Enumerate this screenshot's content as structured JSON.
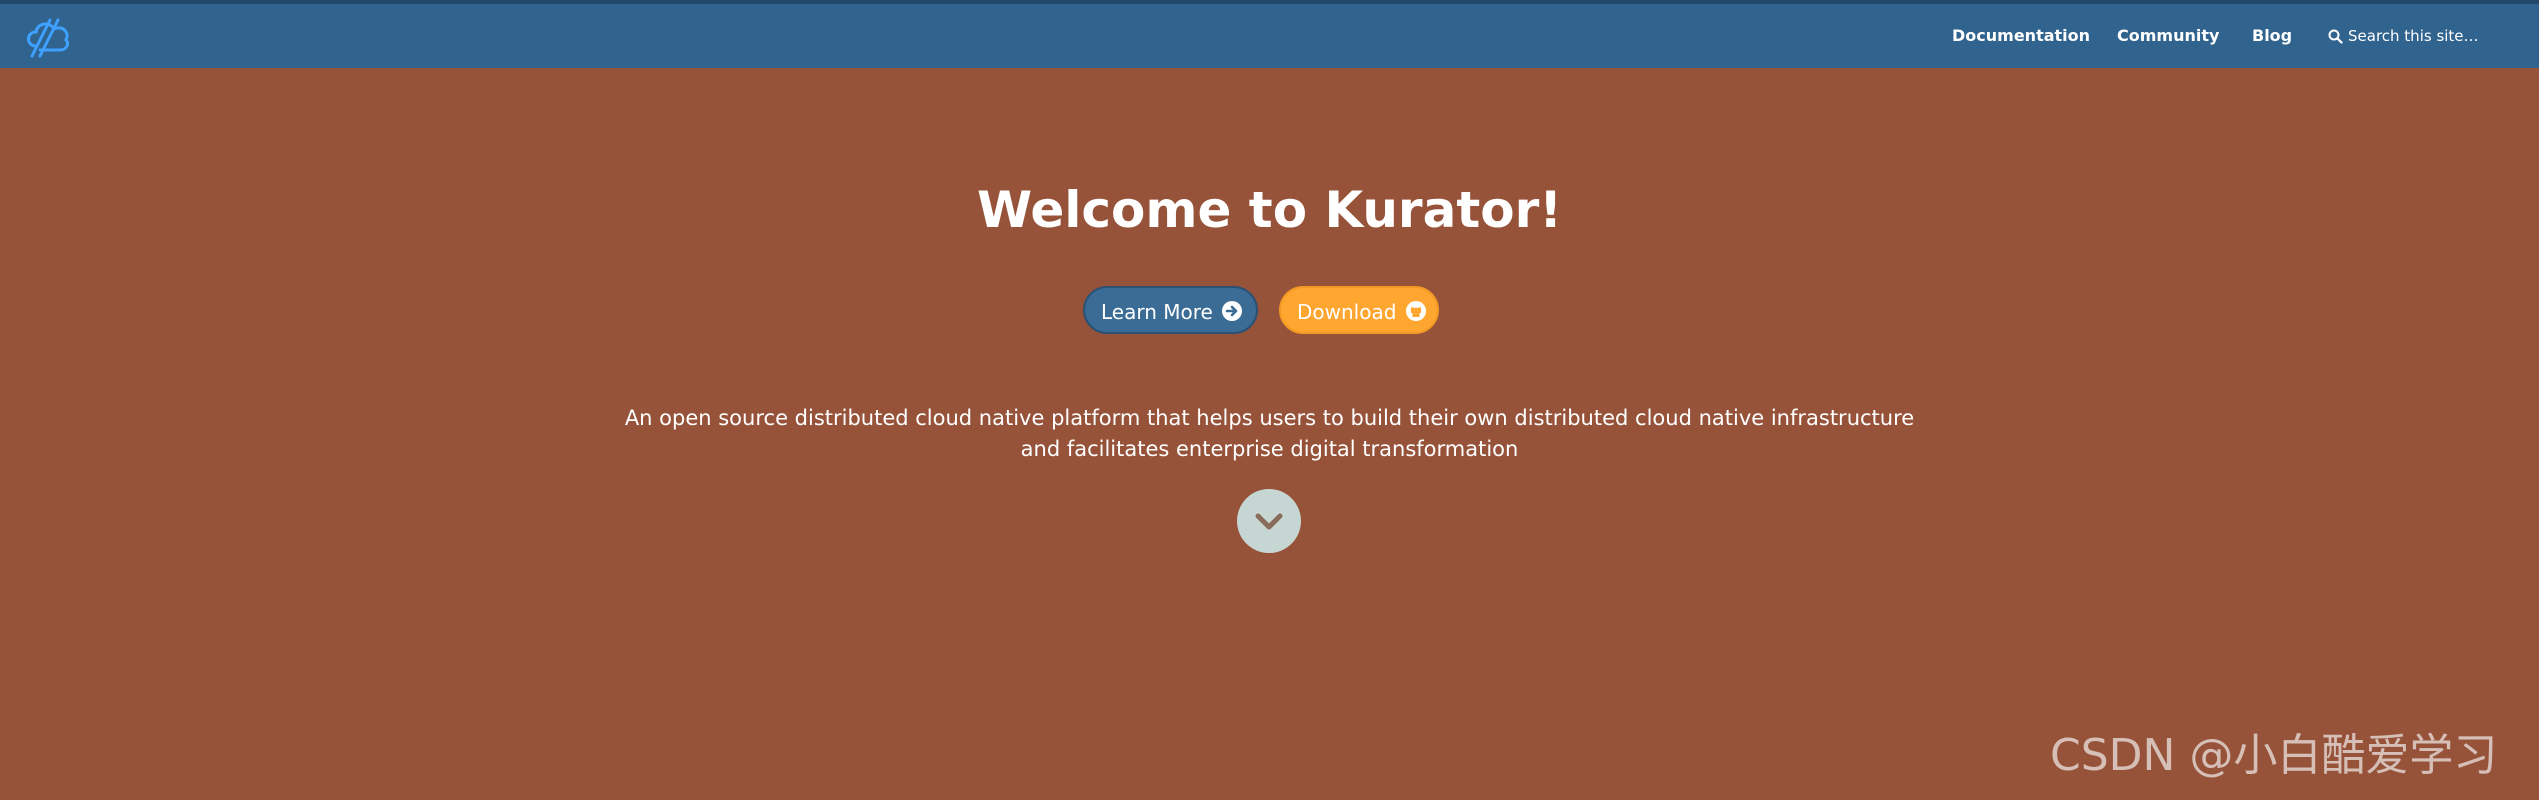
{
  "navbar": {
    "logo": "kurator-logo",
    "links": {
      "documentation": "Documentation",
      "community": "Community",
      "blog": "Blog"
    },
    "search": {
      "placeholder": "Search this site…",
      "icon": "search-icon"
    }
  },
  "hero": {
    "title": "Welcome to Kurator!",
    "buttons": {
      "learn_more": {
        "label": "Learn More",
        "icon": "arrow-circle-right-icon"
      },
      "download": {
        "label": "Download",
        "icon": "github-icon"
      }
    },
    "tagline": {
      "line1": "An open source distributed cloud native platform that helps users to build their own distributed cloud native infrastructure",
      "line2": "and facilitates enterprise digital transformation"
    },
    "scroll_icon": "chevron-down-icon"
  },
  "watermark": "CSDN @小白酷爱学习",
  "colors": {
    "navbar": "#30638e",
    "hero_background": "#97533a",
    "learn_more_button": "#3a6c95",
    "download_button": "#ffa630",
    "scroll_button": "#c6d7d3"
  }
}
